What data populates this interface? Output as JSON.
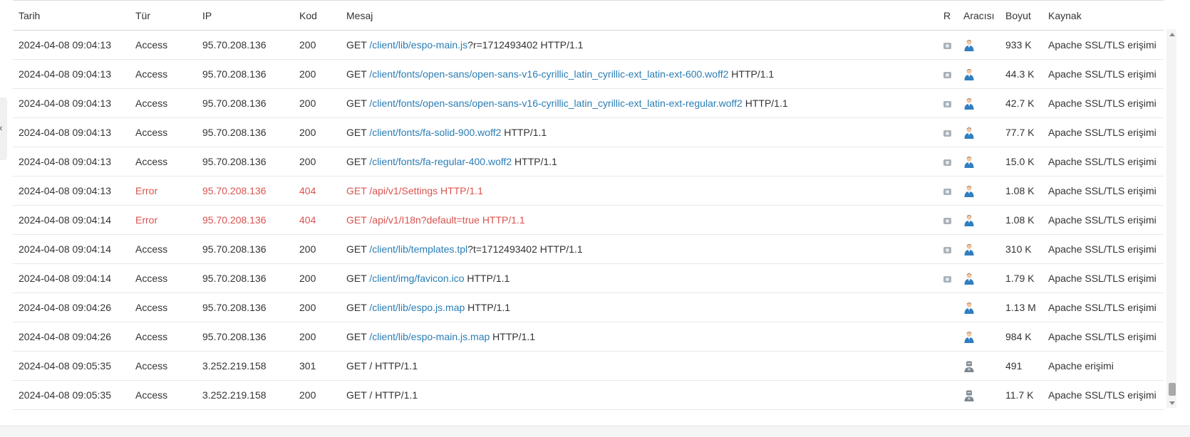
{
  "columns": {
    "date": "Tarih",
    "type": "Tür",
    "ip": "IP",
    "code": "Kod",
    "message": "Mesaj",
    "r": "R",
    "agent": "Aracısı",
    "size": "Boyut",
    "source": "Kaynak"
  },
  "rows": [
    {
      "date": "2024-04-08 09:04:13",
      "type": "Access",
      "ip": "95.70.208.136",
      "code": "200",
      "method": "GET",
      "path": "/client/lib/espo-main.js",
      "query": "?r=1712493402",
      "protocol": " HTTP/1.1",
      "size": "933 K",
      "source": "Apache SSL/TLS erişimi"
    },
    {
      "date": "2024-04-08 09:04:13",
      "type": "Access",
      "ip": "95.70.208.136",
      "code": "200",
      "method": "GET",
      "path": "/client/fonts/open-sans/open-sans-v16-cyrillic_latin_cyrillic-ext_latin-ext-600.woff2",
      "query": "",
      "protocol": " HTTP/1.1",
      "size": "44.3 K",
      "source": "Apache SSL/TLS erişimi"
    },
    {
      "date": "2024-04-08 09:04:13",
      "type": "Access",
      "ip": "95.70.208.136",
      "code": "200",
      "method": "GET",
      "path": "/client/fonts/open-sans/open-sans-v16-cyrillic_latin_cyrillic-ext_latin-ext-regular.woff2",
      "query": "",
      "protocol": " HTTP/1.1",
      "size": "42.7 K",
      "source": "Apache SSL/TLS erişimi"
    },
    {
      "date": "2024-04-08 09:04:13",
      "type": "Access",
      "ip": "95.70.208.136",
      "code": "200",
      "method": "GET",
      "path": "/client/fonts/fa-solid-900.woff2",
      "query": "",
      "protocol": " HTTP/1.1",
      "size": "77.7 K",
      "source": "Apache SSL/TLS erişimi"
    },
    {
      "date": "2024-04-08 09:04:13",
      "type": "Access",
      "ip": "95.70.208.136",
      "code": "200",
      "method": "GET",
      "path": "/client/fonts/fa-regular-400.woff2",
      "query": "",
      "protocol": " HTTP/1.1",
      "size": "15.0 K",
      "source": "Apache SSL/TLS erişimi"
    },
    {
      "date": "2024-04-08 09:04:13",
      "type": "Error",
      "ip": "95.70.208.136",
      "code": "404",
      "method": "GET",
      "path": "",
      "query": "",
      "protocol": " /api/v1/Settings HTTP/1.1",
      "size": "1.08 K",
      "source": "Apache SSL/TLS erişimi"
    },
    {
      "date": "2024-04-08 09:04:14",
      "type": "Error",
      "ip": "95.70.208.136",
      "code": "404",
      "method": "GET",
      "path": "",
      "query": "",
      "protocol": " /api/v1/I18n?default=true HTTP/1.1",
      "size": "1.08 K",
      "source": "Apache SSL/TLS erişimi"
    },
    {
      "date": "2024-04-08 09:04:14",
      "type": "Access",
      "ip": "95.70.208.136",
      "code": "200",
      "method": "GET",
      "path": "/client/lib/templates.tpl",
      "query": "?t=1712493402",
      "protocol": " HTTP/1.1",
      "size": "310 K",
      "source": "Apache SSL/TLS erişimi"
    },
    {
      "date": "2024-04-08 09:04:14",
      "type": "Access",
      "ip": "95.70.208.136",
      "code": "200",
      "method": "GET",
      "path": "/client/img/favicon.ico",
      "query": "",
      "protocol": " HTTP/1.1",
      "size": "1.79 K",
      "source": "Apache SSL/TLS erişimi"
    },
    {
      "date": "2024-04-08 09:04:26",
      "type": "Access",
      "ip": "95.70.208.136",
      "code": "200",
      "method": "GET",
      "path": "/client/lib/espo.js.map",
      "query": "",
      "protocol": " HTTP/1.1",
      "size": "1.13 M",
      "source": "Apache SSL/TLS erişimi"
    },
    {
      "date": "2024-04-08 09:04:26",
      "type": "Access",
      "ip": "95.70.208.136",
      "code": "200",
      "method": "GET",
      "path": "/client/lib/espo-main.js.map",
      "query": "",
      "protocol": " HTTP/1.1",
      "size": "984 K",
      "source": "Apache SSL/TLS erişimi"
    },
    {
      "date": "2024-04-08 09:05:35",
      "type": "Access",
      "ip": "3.252.219.158",
      "code": "301",
      "method": "GET",
      "path": "",
      "query": "",
      "protocol": " / HTTP/1.1",
      "size": "491",
      "source": "Apache erişimi"
    },
    {
      "date": "2024-04-08 09:05:35",
      "type": "Access",
      "ip": "3.252.219.158",
      "code": "200",
      "method": "GET",
      "path": "",
      "query": "",
      "protocol": " / HTTP/1.1",
      "size": "11.7 K",
      "source": "Apache SSL/TLS erişimi"
    }
  ],
  "row_flags": [
    {
      "error": false,
      "has_r": true,
      "agent": "user"
    },
    {
      "error": false,
      "has_r": true,
      "agent": "user"
    },
    {
      "error": false,
      "has_r": true,
      "agent": "user"
    },
    {
      "error": false,
      "has_r": true,
      "agent": "user"
    },
    {
      "error": false,
      "has_r": true,
      "agent": "user"
    },
    {
      "error": true,
      "has_r": true,
      "agent": "user"
    },
    {
      "error": true,
      "has_r": true,
      "agent": "user"
    },
    {
      "error": false,
      "has_r": true,
      "agent": "user"
    },
    {
      "error": false,
      "has_r": true,
      "agent": "user"
    },
    {
      "error": false,
      "has_r": false,
      "agent": "user"
    },
    {
      "error": false,
      "has_r": false,
      "agent": "user"
    },
    {
      "error": false,
      "has_r": false,
      "agent": "bot"
    },
    {
      "error": false,
      "has_r": false,
      "agent": "bot"
    }
  ],
  "icons": {
    "r": "eye-icon",
    "user": "user-icon",
    "bot": "bot-icon",
    "side_tab": "chevron-left-icon"
  },
  "colors": {
    "link": "#2a7db5",
    "error": "#d9534f",
    "user_shirt": "#2f7fc1",
    "bot": "#7d8790"
  }
}
